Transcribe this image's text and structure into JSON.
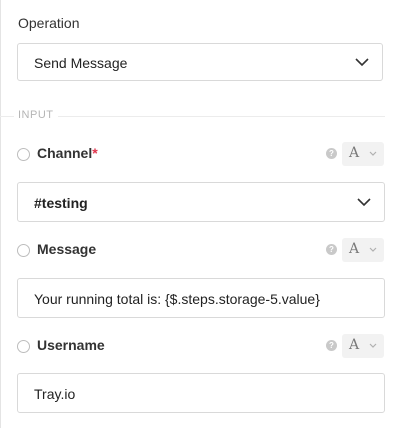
{
  "operation": {
    "label": "Operation",
    "selected": "Send Message"
  },
  "section": {
    "label": "INPUT"
  },
  "fields": {
    "channel": {
      "label": "Channel",
      "required_mark": "*",
      "help_glyph": "?",
      "type_glyph": "A",
      "value": "#testing"
    },
    "message": {
      "label": "Message",
      "help_glyph": "?",
      "type_glyph": "A",
      "value": "Your running total is: {$.steps.storage-5.value}"
    },
    "username": {
      "label": "Username",
      "help_glyph": "?",
      "type_glyph": "A",
      "value": "Tray.io"
    }
  },
  "icons": {
    "chevron": "chevron-down-icon",
    "help": "question-circle-icon",
    "type": "text-type-icon",
    "radio": "radio-icon"
  },
  "colors": {
    "border": "#d9d9d9",
    "required": "#e0344c",
    "muted": "#b5b5b5"
  }
}
